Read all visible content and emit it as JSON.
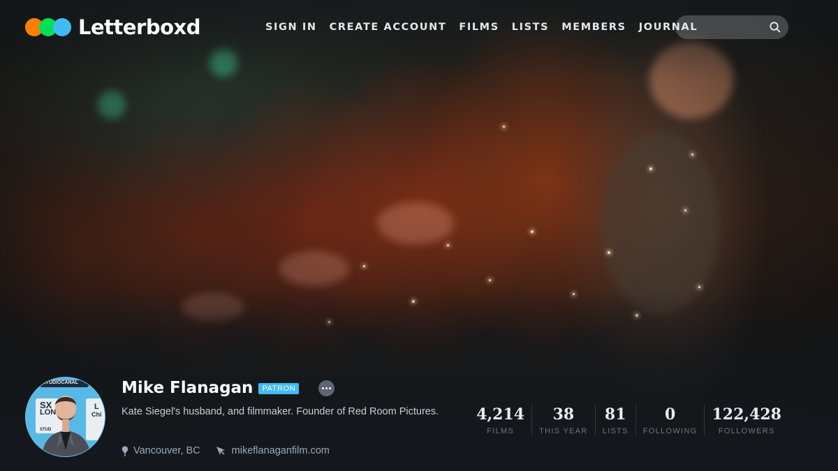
{
  "brand": {
    "name": "Letterboxd",
    "dot_colors": [
      "#ff8000",
      "#00e054",
      "#40bcf4"
    ]
  },
  "nav": {
    "items": [
      {
        "label": "SIGN IN"
      },
      {
        "label": "CREATE ACCOUNT"
      },
      {
        "label": "FILMS"
      },
      {
        "label": "LISTS"
      },
      {
        "label": "MEMBERS"
      },
      {
        "label": "JOURNAL"
      }
    ]
  },
  "search": {
    "placeholder": "",
    "icon": "search-icon"
  },
  "profile": {
    "name": "Mike Flanagan",
    "badge": "PATRON",
    "bio": "Kate Siegel's husband, and filmmaker. Founder of Red Room Pictures.",
    "location": "Vancouver, BC",
    "website": "mikeflanaganfilm.com",
    "avatar_backdrop_text": [
      "SX",
      "LON",
      "L",
      "Chi",
      "STUD",
      "STUDIOCANAL"
    ]
  },
  "stats": [
    {
      "value": "4,214",
      "label": "FILMS"
    },
    {
      "value": "38",
      "label": "THIS YEAR"
    },
    {
      "value": "81",
      "label": "LISTS"
    },
    {
      "value": "0",
      "label": "FOLLOWING"
    },
    {
      "value": "122,428",
      "label": "FOLLOWERS"
    }
  ],
  "colors": {
    "accent": "#40bcf4",
    "background": "#14181c",
    "muted_text": "#99aabb"
  }
}
